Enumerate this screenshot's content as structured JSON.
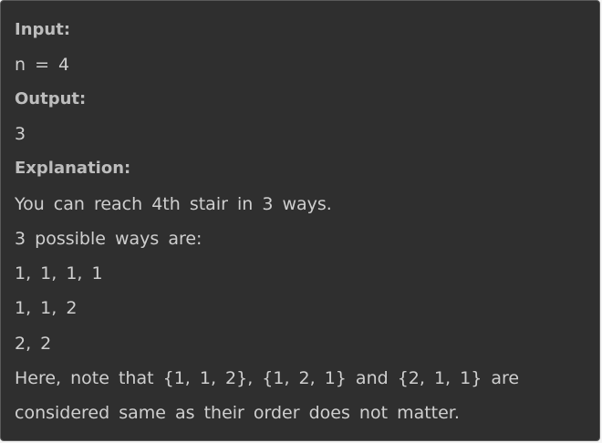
{
  "example": {
    "input_label": "Input:",
    "input_value": "n = 4",
    "output_label": "Output:",
    "output_value": "3",
    "explanation_label": "Explanation:",
    "explanation_lines": [
      "You can reach 4th stair in 3 ways.",
      "3 possible ways are:",
      "1, 1, 1, 1",
      "1, 1, 2",
      "2, 2",
      "Here, note that {1, 1, 2}, {1, 2, 1} and {2, 1, 1} are",
      "considered same as their order does not matter."
    ]
  }
}
